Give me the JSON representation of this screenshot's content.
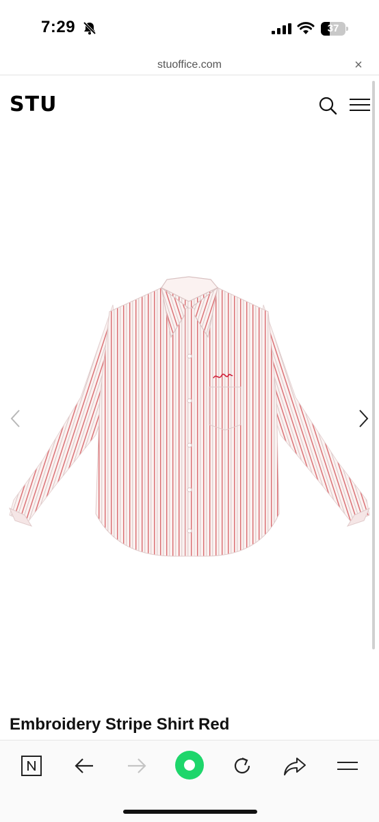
{
  "status_bar": {
    "time": "7:29",
    "battery_level": "37"
  },
  "browser": {
    "url": "stuoffice.com",
    "close_symbol": "×"
  },
  "site": {
    "logo_text": "STU"
  },
  "product": {
    "title": "Embroidery Stripe Shirt Red",
    "colors": {
      "stripe": "#d96a6f",
      "fabric": "#fbf2f1",
      "embroidery": "#d0203a"
    }
  },
  "icons": {
    "header": [
      "search-icon",
      "menu-icon"
    ],
    "carousel": [
      "chevron-left-icon",
      "chevron-right-icon"
    ],
    "toolbar": [
      "naver-logo-icon",
      "back-icon",
      "forward-icon",
      "green-dot-icon",
      "reload-icon",
      "share-icon",
      "menu-icon"
    ]
  },
  "accent_colors": {
    "green": "#1ed66b"
  }
}
